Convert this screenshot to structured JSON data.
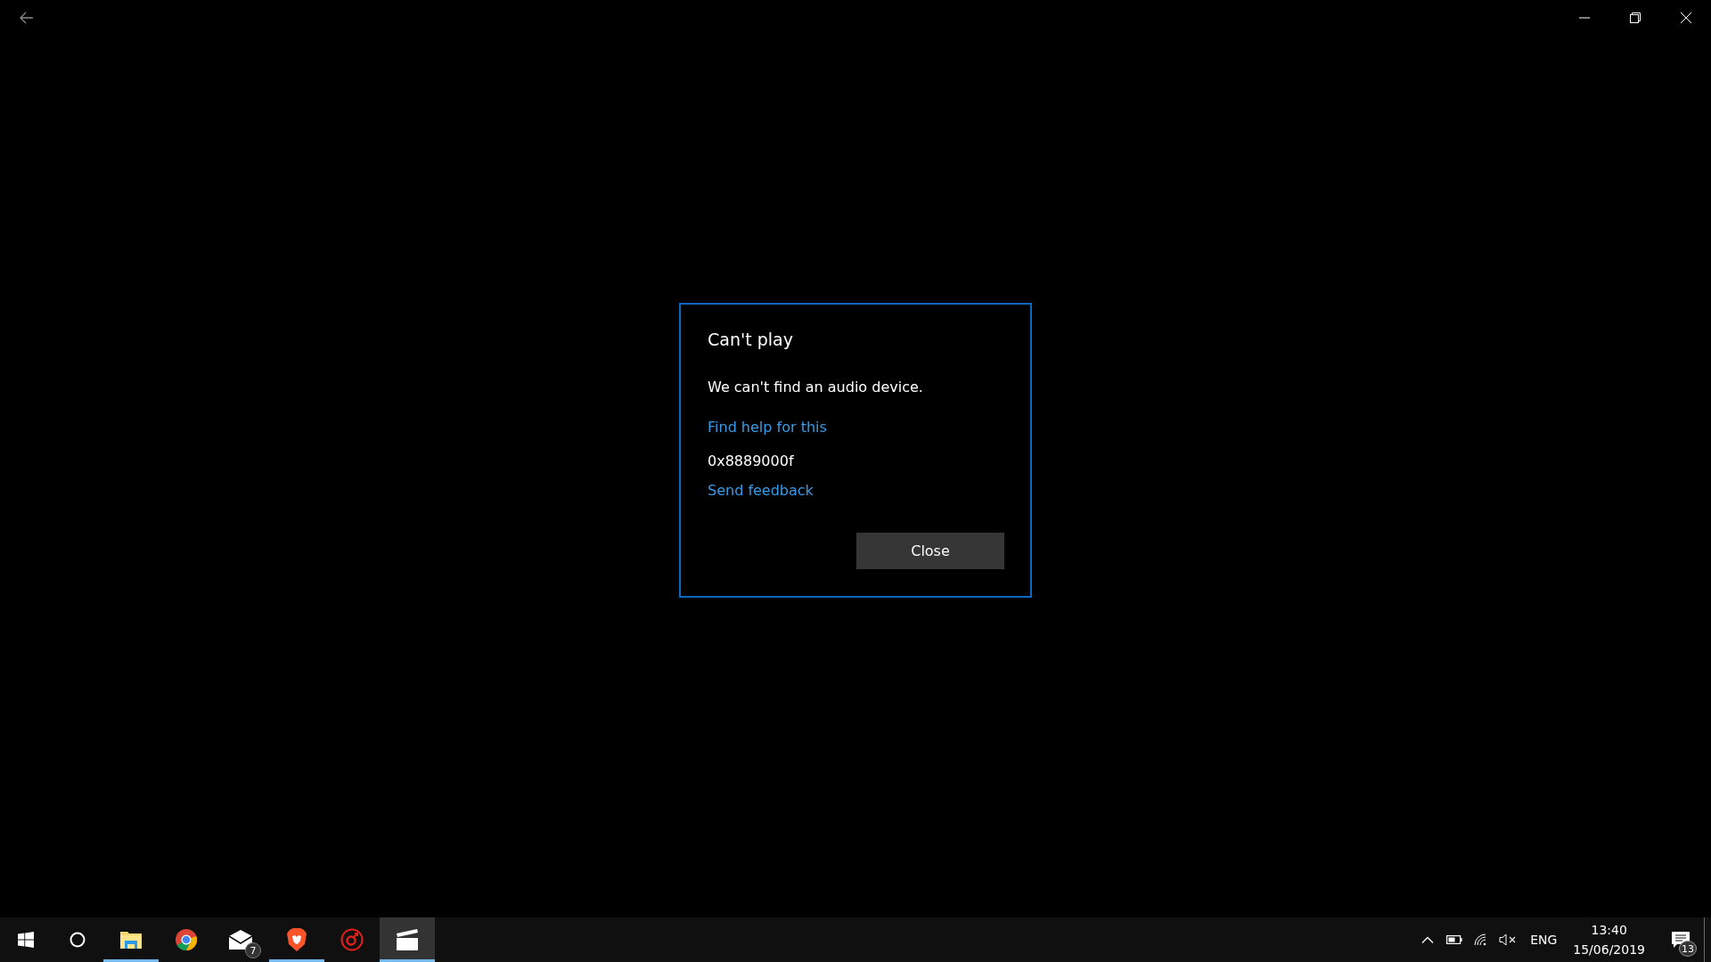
{
  "dialog": {
    "title": "Can't play",
    "message": "We can't find an audio device.",
    "help_link": "Find help for this",
    "error_code": "0x8889000f",
    "feedback_link": "Send feedback",
    "button": "Close"
  },
  "taskbar": {
    "apps": [
      {
        "kind": "start",
        "running": false,
        "selected": false
      },
      {
        "kind": "search",
        "running": false,
        "selected": false
      },
      {
        "kind": "folder",
        "running": true,
        "selected": false
      },
      {
        "kind": "browser",
        "running": false,
        "selected": false
      },
      {
        "kind": "mail",
        "running": false,
        "selected": false,
        "badge": "7"
      },
      {
        "kind": "lion",
        "running": true,
        "selected": false
      },
      {
        "kind": "booster",
        "running": false,
        "selected": false
      },
      {
        "kind": "movies",
        "running": true,
        "selected": true
      }
    ],
    "tray": {
      "language": "ENG",
      "time": "13:40",
      "date": "15/06/2019",
      "notification_count": "13"
    }
  }
}
